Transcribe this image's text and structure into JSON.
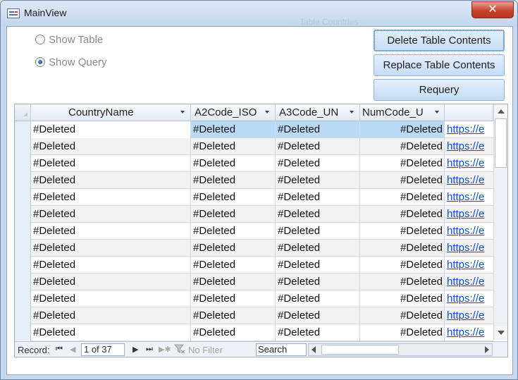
{
  "window": {
    "title": "MainView",
    "background_title": "Table Countries",
    "close_glyph": "✕"
  },
  "view_options": [
    {
      "label": "Show Table",
      "checked": false
    },
    {
      "label": "Show Query",
      "checked": true
    }
  ],
  "buttons": {
    "delete": "Delete Table Contents",
    "replace": "Replace Table Contents",
    "requery": "Requery"
  },
  "table": {
    "columns": [
      "CountryName",
      "A2Code_ISO",
      "A3Code_UN",
      "NumCode_U",
      ""
    ],
    "rows": [
      [
        "#Deleted",
        "#Deleted",
        "#Deleted",
        "#Deleted",
        "https://e"
      ],
      [
        "#Deleted",
        "#Deleted",
        "#Deleted",
        "#Deleted",
        "https://e"
      ],
      [
        "#Deleted",
        "#Deleted",
        "#Deleted",
        "#Deleted",
        "https://e"
      ],
      [
        "#Deleted",
        "#Deleted",
        "#Deleted",
        "#Deleted",
        "https://e"
      ],
      [
        "#Deleted",
        "#Deleted",
        "#Deleted",
        "#Deleted",
        "https://e"
      ],
      [
        "#Deleted",
        "#Deleted",
        "#Deleted",
        "#Deleted",
        "https://e"
      ],
      [
        "#Deleted",
        "#Deleted",
        "#Deleted",
        "#Deleted",
        "https://e"
      ],
      [
        "#Deleted",
        "#Deleted",
        "#Deleted",
        "#Deleted",
        "https://e"
      ],
      [
        "#Deleted",
        "#Deleted",
        "#Deleted",
        "#Deleted",
        "https://e"
      ],
      [
        "#Deleted",
        "#Deleted",
        "#Deleted",
        "#Deleted",
        "https://e"
      ],
      [
        "#Deleted",
        "#Deleted",
        "#Deleted",
        "#Deleted",
        "https://e"
      ],
      [
        "#Deleted",
        "#Deleted",
        "#Deleted",
        "#Deleted",
        "https://e"
      ],
      [
        "#Deleted",
        "#Deleted",
        "#Deleted",
        "#Deleted",
        "https://e"
      ]
    ],
    "current_row": 0
  },
  "navigation": {
    "record_label": "Record:",
    "position": "1 of 37",
    "no_filter": "No Filter",
    "search": "Search"
  },
  "colors": {
    "selection": "#b9d9f7",
    "link": "#0b50c8",
    "button": "#c5dcf6"
  }
}
